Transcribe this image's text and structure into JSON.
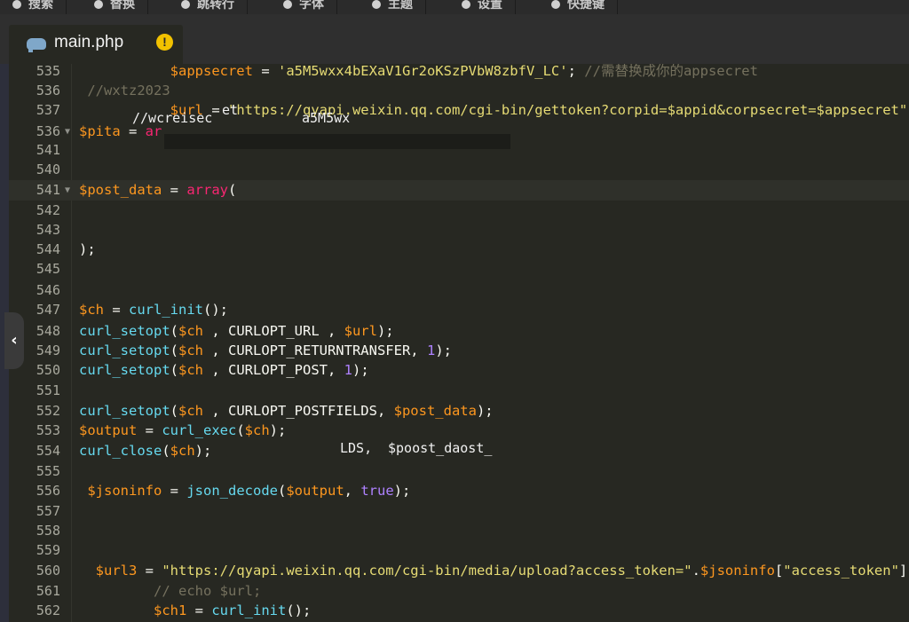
{
  "toolbar": {
    "items": [
      {
        "label": "搜索",
        "icon": "search-icon"
      },
      {
        "label": "替换",
        "icon": "replace-icon"
      },
      {
        "label": "跳转行",
        "icon": "goto-line-icon"
      },
      {
        "label": "字体",
        "icon": "font-icon"
      },
      {
        "label": "主题",
        "icon": "theme-icon"
      },
      {
        "label": "设置",
        "icon": "settings-icon"
      },
      {
        "label": "快捷键",
        "icon": "keyboard-icon"
      }
    ]
  },
  "tab": {
    "filename": "main.php",
    "icon": "php-elephant-icon",
    "warning_glyph": "!"
  },
  "editor": {
    "lines": [
      {
        "n": "535",
        "indent": "           ",
        "tokens": [
          [
            "v",
            "$appsecret"
          ],
          [
            "p",
            " = "
          ],
          [
            "s",
            "'a5M5wxx4bEXaV1Gr2oKSzPVbW8zbfV_LC'"
          ],
          [
            "p",
            "; "
          ],
          [
            "c",
            "//需替换成你的appsecret"
          ]
        ]
      },
      {
        "n": "536",
        "indent": " ",
        "tokens": [
          [
            "c",
            "//wxtz2023"
          ]
        ]
      },
      {
        "n": "537",
        "indent": "           ",
        "tokens": [
          [
            "v",
            "$url"
          ],
          [
            "p",
            " = "
          ],
          [
            "s",
            "\"https://qyapi.weixin.qq.com/cgi-bin/gettoken?corpid=$appid&corpsecret=$appsecret\""
          ],
          [
            "p",
            ";"
          ]
        ]
      },
      {
        "n": "536",
        "indent": "",
        "fold": true,
        "tokens": [
          [
            "v",
            "$pita"
          ],
          [
            "p",
            " = "
          ],
          [
            "k",
            "ar"
          ]
        ]
      },
      {
        "n": "541",
        "indent": "",
        "tokens": []
      },
      {
        "n": "540",
        "indent": "",
        "tokens": []
      },
      {
        "n": "541",
        "indent": "",
        "fold": true,
        "hl": true,
        "tokens": [
          [
            "v",
            "$post_data"
          ],
          [
            "p",
            " = "
          ],
          [
            "k",
            "array"
          ],
          [
            "p",
            "("
          ]
        ]
      },
      {
        "n": "542",
        "indent": "",
        "tokens": []
      },
      {
        "n": "543",
        "indent": "",
        "tokens": []
      },
      {
        "n": "544",
        "indent": "",
        "tokens": [
          [
            "p",
            ");"
          ]
        ]
      },
      {
        "n": "545",
        "indent": "",
        "tokens": []
      },
      {
        "n": "546",
        "indent": "",
        "tokens": []
      },
      {
        "n": "547",
        "indent": "",
        "tokens": [
          [
            "v",
            "$ch"
          ],
          [
            "p",
            " = "
          ],
          [
            "f",
            "curl_init"
          ],
          [
            "p",
            "();"
          ]
        ]
      },
      {
        "n": "548",
        "indent": "",
        "tokens": [
          [
            "f",
            "curl_setopt"
          ],
          [
            "p",
            "("
          ],
          [
            "v",
            "$ch"
          ],
          [
            "p",
            " , CURLOPT_URL , "
          ],
          [
            "v",
            "$url"
          ],
          [
            "p",
            ");"
          ]
        ]
      },
      {
        "n": "549",
        "indent": "",
        "tokens": [
          [
            "f",
            "curl_setopt"
          ],
          [
            "p",
            "("
          ],
          [
            "v",
            "$ch"
          ],
          [
            "p",
            " , CURLOPT_RETURNTRANSFER, "
          ],
          [
            "n",
            "1"
          ],
          [
            "p",
            ");"
          ]
        ]
      },
      {
        "n": "550",
        "indent": "",
        "tokens": [
          [
            "f",
            "curl_setopt"
          ],
          [
            "p",
            "("
          ],
          [
            "v",
            "$ch"
          ],
          [
            "p",
            " , CURLOPT_POST, "
          ],
          [
            "n",
            "1"
          ],
          [
            "p",
            ");"
          ]
        ]
      },
      {
        "n": "551",
        "indent": "",
        "tokens": []
      },
      {
        "n": "552",
        "indent": "",
        "tokens": [
          [
            "f",
            "curl_setopt"
          ],
          [
            "p",
            "("
          ],
          [
            "v",
            "$ch"
          ],
          [
            "p",
            " , CURLOPT_POSTFIELDS, "
          ],
          [
            "v",
            "$post_data"
          ],
          [
            "p",
            ");"
          ]
        ]
      },
      {
        "n": "553",
        "indent": "",
        "tokens": [
          [
            "v",
            "$output"
          ],
          [
            "p",
            " = "
          ],
          [
            "f",
            "curl_exec"
          ],
          [
            "p",
            "("
          ],
          [
            "v",
            "$ch"
          ],
          [
            "p",
            ");"
          ]
        ]
      },
      {
        "n": "554",
        "indent": "",
        "tokens": [
          [
            "f",
            "curl_close"
          ],
          [
            "p",
            "("
          ],
          [
            "v",
            "$ch"
          ],
          [
            "p",
            ");"
          ]
        ]
      },
      {
        "n": "555",
        "indent": "",
        "tokens": []
      },
      {
        "n": "556",
        "indent": " ",
        "tokens": [
          [
            "v",
            "$jsoninfo"
          ],
          [
            "p",
            " = "
          ],
          [
            "f",
            "json_decode"
          ],
          [
            "p",
            "("
          ],
          [
            "v",
            "$output"
          ],
          [
            "p",
            ", "
          ],
          [
            "n",
            "true"
          ],
          [
            "p",
            ");"
          ]
        ]
      },
      {
        "n": "557",
        "indent": "",
        "tokens": []
      },
      {
        "n": "558",
        "indent": "",
        "tokens": []
      },
      {
        "n": "559",
        "indent": "",
        "tokens": []
      },
      {
        "n": "560",
        "indent": "  ",
        "tokens": [
          [
            "v",
            "$url3"
          ],
          [
            "p",
            " = "
          ],
          [
            "s",
            "\"https://qyapi.weixin.qq.com/cgi-bin/media/upload?access_token=\""
          ],
          [
            "p",
            "."
          ],
          [
            "v",
            "$jsoninfo"
          ],
          [
            "p",
            "["
          ],
          [
            "s",
            "\"access_token\""
          ],
          [
            "p",
            "]"
          ]
        ]
      },
      {
        "n": "561",
        "indent": "         ",
        "tokens": [
          [
            "c",
            "// echo $url;"
          ]
        ]
      },
      {
        "n": "562",
        "indent": "         ",
        "tokens": [
          [
            "v",
            "$ch1"
          ],
          [
            "p",
            " = "
          ],
          [
            "f",
            "curl_init"
          ],
          [
            "p",
            "();"
          ]
        ]
      }
    ],
    "ghosts": [
      {
        "text": "//wcreisec",
        "cls": "c"
      },
      {
        "text": "et",
        "cls": "p"
      },
      {
        "text": "a5M5wx",
        "cls": "p"
      },
      {
        "text": "LDS,",
        "cls": "p"
      },
      {
        "text": "$poost_daost_",
        "cls": "s"
      }
    ],
    "collapse_glyph": "‹"
  }
}
